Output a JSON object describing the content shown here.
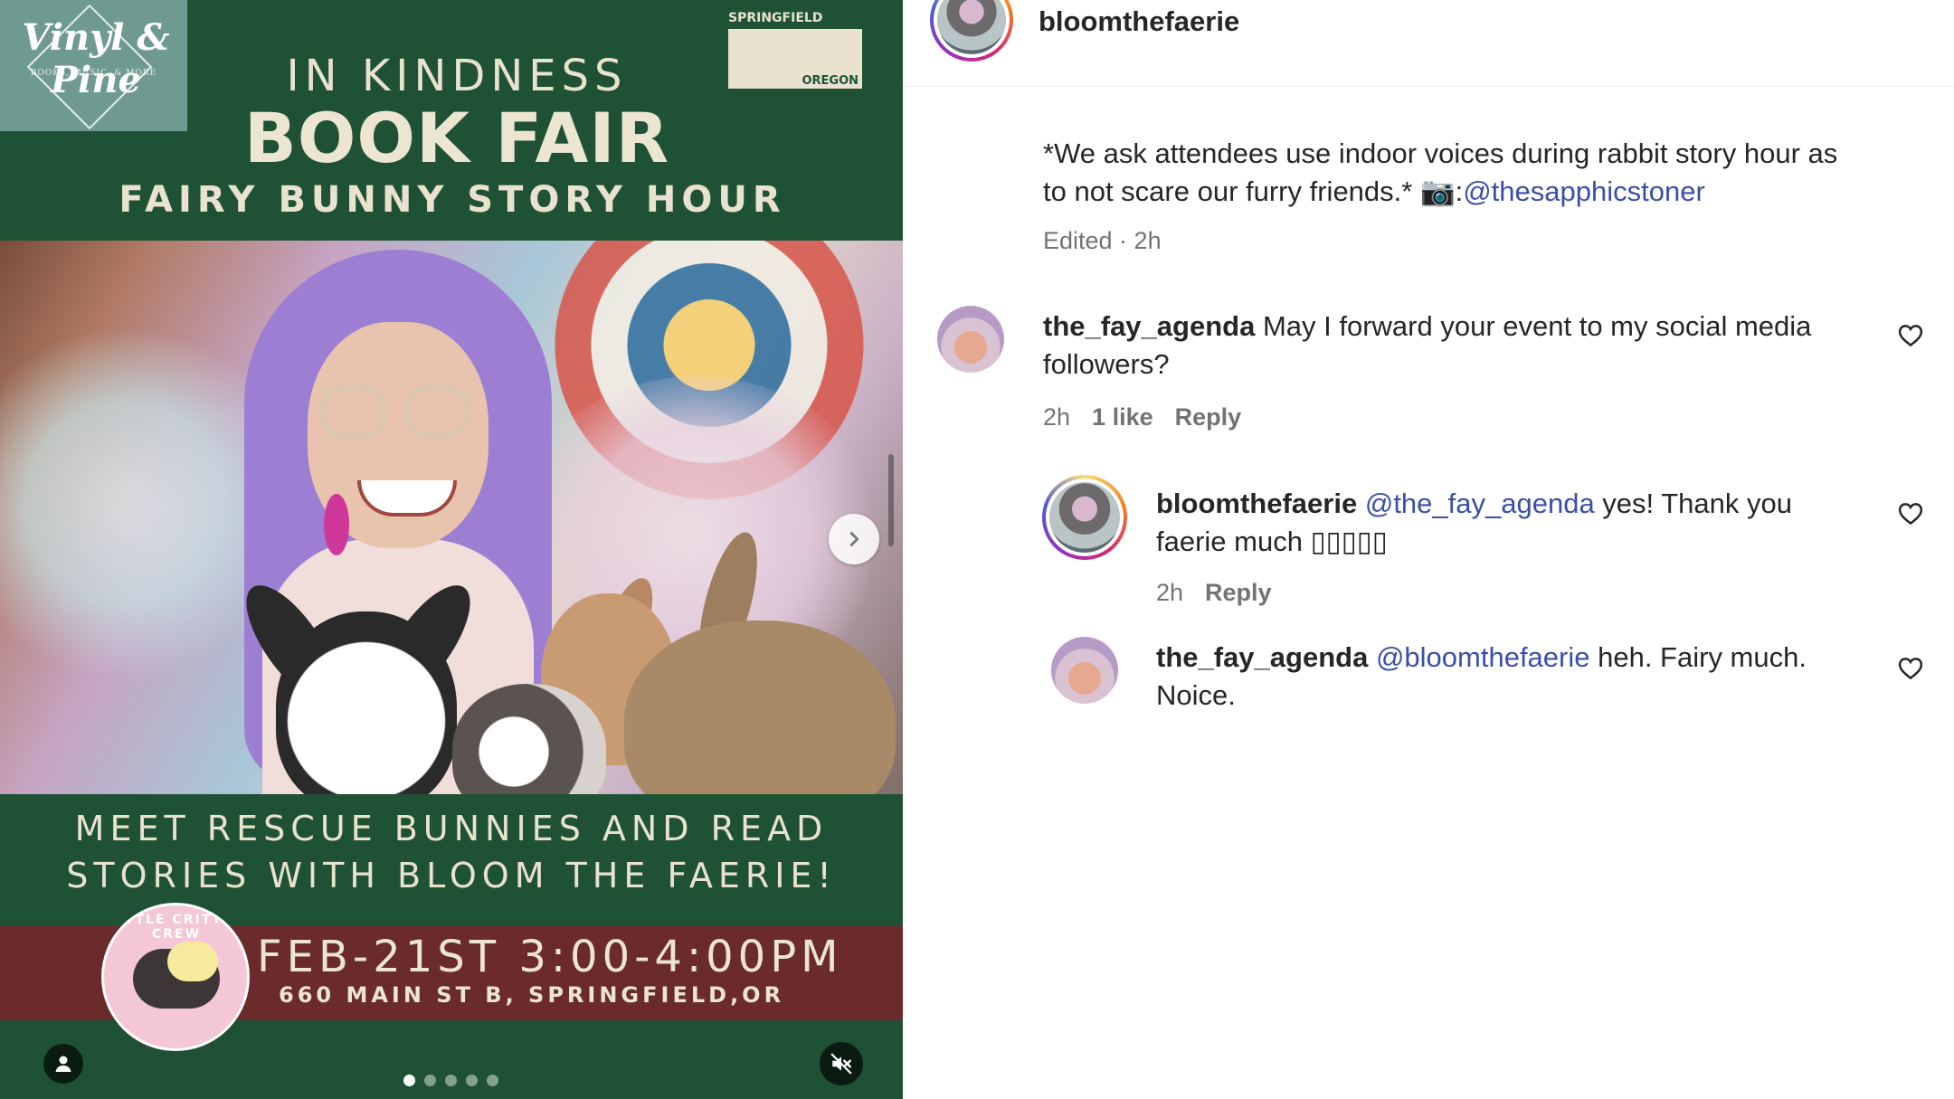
{
  "post_media": {
    "logo_vinyl": {
      "name": "Vinyl & Pine",
      "tagline": "BOOKS, MUSIC, & MORE"
    },
    "logo_springfield": {
      "top": "SPRINGFIELD",
      "bottom": "OREGON"
    },
    "headline_1": "IN KINDNESS",
    "headline_2": "BOOK FAIR",
    "headline_3": "FAIRY BUNNY STORY HOUR",
    "tagline_1": "MEET RESCUE BUNNIES AND READ",
    "tagline_2": "STORIES WITH BLOOM THE FAERIE!",
    "date_time": "FEB-21ST 3:00-4:00PM",
    "address": "660 MAIN ST B, SPRINGFIELD,OR",
    "critter_logo": "LITTLE CRITTER CREW",
    "carousel": {
      "count": 5,
      "active_index": 0
    }
  },
  "header": {
    "username": "bloomthefaerie"
  },
  "caption": {
    "text_1": "*We ask attendees use indoor voices during rabbit story hour as",
    "text_2": "to not scare our furry friends.* ",
    "camera_icon": "📷",
    "colon": ":",
    "mention": "@thesapphicstoner",
    "meta": "Edited · 2h"
  },
  "comments": [
    {
      "username": "the_fay_agenda",
      "text_1": "May I forward your event to my social media",
      "text_2": "followers?",
      "time": "2h",
      "likes": "1 like",
      "reply": "Reply"
    },
    {
      "username": "bloomthefaerie",
      "mention": "@the_fay_agenda",
      "text_1": " yes! Thank you",
      "text_2": "faerie much ▯▯▯▯▯",
      "time": "2h",
      "reply": "Reply"
    },
    {
      "username": "the_fay_agenda",
      "mention": "@bloomthefaerie",
      "text_1": " heh. Fairy much.",
      "text_2": "Noice."
    }
  ]
}
